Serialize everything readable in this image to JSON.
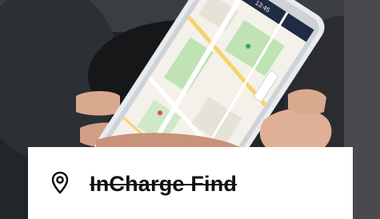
{
  "photo": {
    "subject": "hand holding smartphone showing map inside car",
    "phone_status_time": "13:45"
  },
  "card": {
    "icon": "location-pin-icon",
    "title": "InCharge Find"
  },
  "colors": {
    "card_background": "#ffffff",
    "text": "#111111",
    "map_green": "#bfe3b4",
    "map_road_yellow": "#f6d36a",
    "phone_header": "#1f2a44"
  }
}
